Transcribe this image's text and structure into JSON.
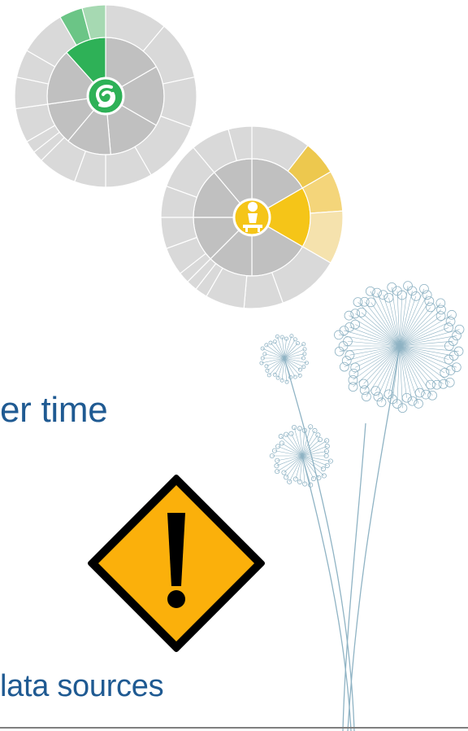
{
  "text_line_1": "er time",
  "text_line_2": "lata sources",
  "icons": {
    "wheel_top": "hurricane-icon",
    "wheel_right": "person-at-desk-icon",
    "warning": "exclamation-warning-icon",
    "decoration": "dandelion-flower-illustration"
  },
  "colors": {
    "text": "#1f5a92",
    "green": "#2eb157",
    "yellow": "#f5c518",
    "warning_fill": "#fbb00b",
    "ring_light": "#d9d9d9",
    "ring_mid": "#c0c0c0",
    "stem": "#8fb3c4"
  }
}
